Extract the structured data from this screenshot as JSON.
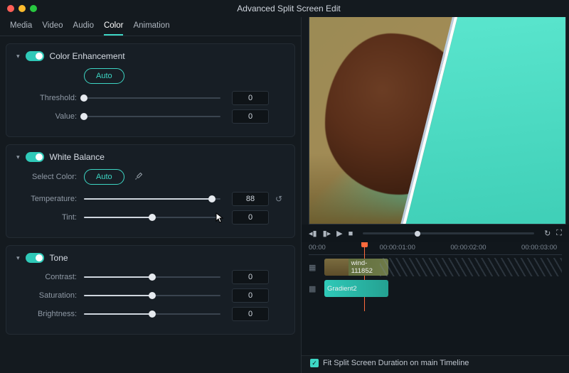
{
  "window": {
    "title": "Advanced Split Screen Edit"
  },
  "traffic_colors": {
    "close": "#ff5f57",
    "min": "#febc2e",
    "max": "#28c840"
  },
  "tabs": {
    "items": [
      "Media",
      "Video",
      "Audio",
      "Color",
      "Animation"
    ],
    "active": "Color"
  },
  "panels": {
    "color_enhancement": {
      "title": "Color Enhancement",
      "enabled": true,
      "auto_label": "Auto",
      "threshold_label": "Threshold:",
      "threshold_value": "0",
      "value_label": "Value:",
      "value_value": "0"
    },
    "white_balance": {
      "title": "White Balance",
      "enabled": true,
      "select_color_label": "Select Color:",
      "auto_label": "Auto",
      "temperature_label": "Temperature:",
      "temperature_value": "88",
      "tint_label": "Tint:",
      "tint_value": "0"
    },
    "tone": {
      "title": "Tone",
      "enabled": true,
      "contrast_label": "Contrast:",
      "contrast_value": "0",
      "saturation_label": "Saturation:",
      "saturation_value": "0",
      "brightness_label": "Brightness:",
      "brightness_value": "0"
    }
  },
  "timeline": {
    "ticks": [
      "00:00",
      "00:00:01:00",
      "00:00:02:00",
      "00:00:03:00"
    ],
    "clips": [
      {
        "name": "wind-111852"
      },
      {
        "name": "Gradient2"
      }
    ]
  },
  "footer": {
    "fit_label": "Fit Split Screen Duration on main Timeline",
    "fit_checked": true
  },
  "accent": "#3dd6c4"
}
